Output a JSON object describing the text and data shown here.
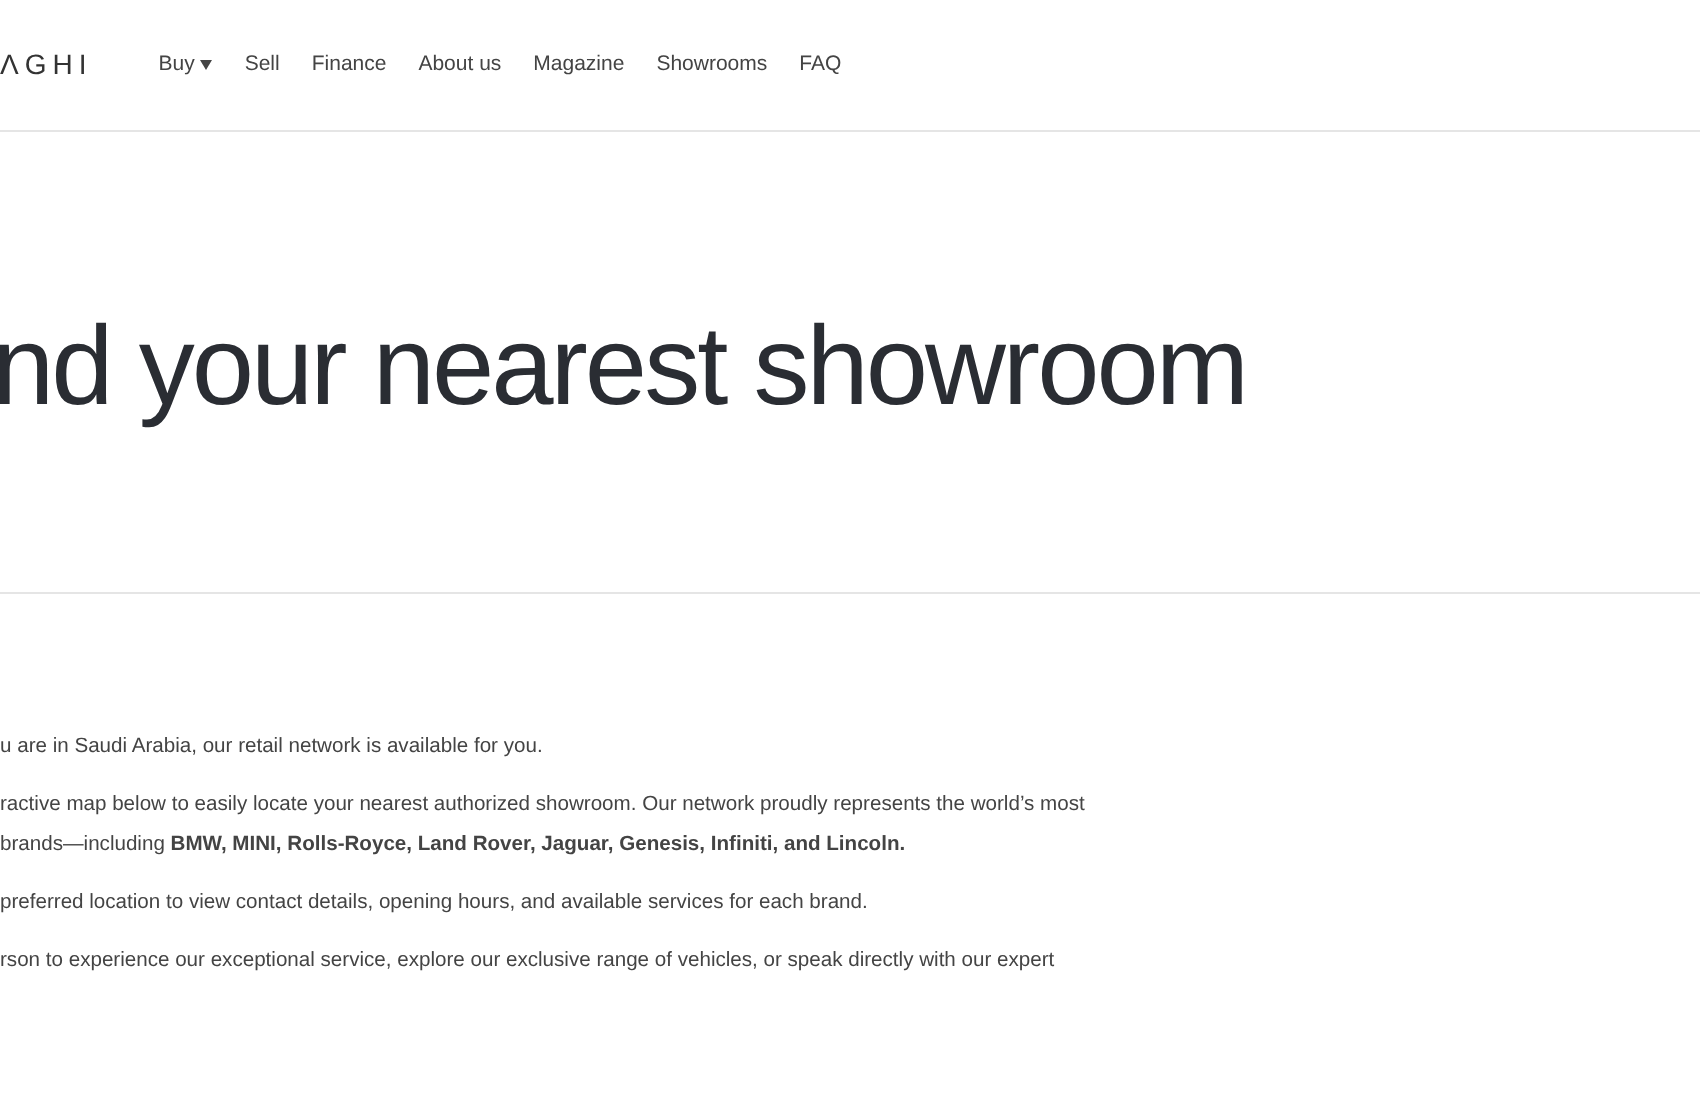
{
  "header": {
    "logo": "ΛGHI",
    "nav": [
      {
        "label": "Buy",
        "dropdown": true
      },
      {
        "label": "Sell",
        "dropdown": false
      },
      {
        "label": "Finance",
        "dropdown": false
      },
      {
        "label": "About us",
        "dropdown": false
      },
      {
        "label": "Magazine",
        "dropdown": false
      },
      {
        "label": "Showrooms",
        "dropdown": false
      },
      {
        "label": "FAQ",
        "dropdown": false
      }
    ]
  },
  "heading": "nd your nearest showroom",
  "paragraphs": [
    [
      "u are in Saudi Arabia, our retail network is available for you."
    ],
    [
      "ractive map below to easily locate your nearest authorized showroom. Our network proudly represents the world’s most",
      "brands—including **BMW, MINI, Rolls-Royce, Land Rover, Jaguar, Genesis, Infiniti, and Lincoln.**"
    ],
    [
      "preferred location to view contact details, opening hours, and available services for each brand."
    ],
    [
      "rson to experience our exceptional service, explore our exclusive range of vehicles, or speak directly with our expert"
    ]
  ]
}
